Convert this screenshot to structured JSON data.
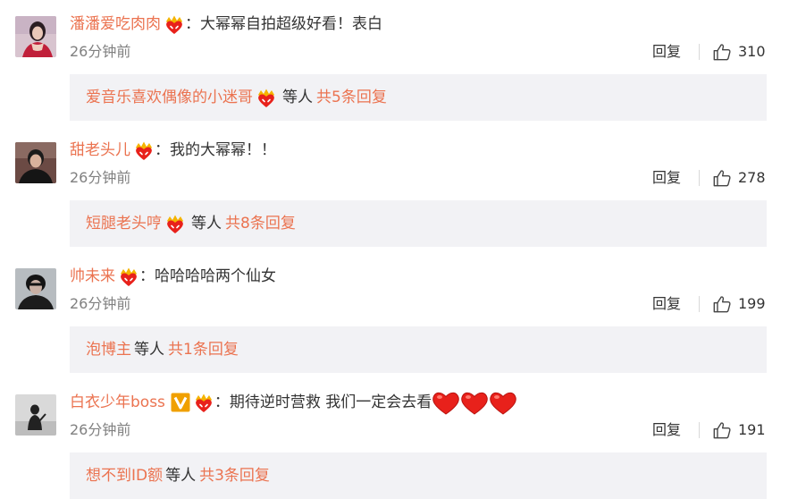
{
  "comments": [
    {
      "username": "潘潘爱吃肉肉",
      "text": "：大幂幂自拍超级好看！表白",
      "time": "26分钟前",
      "reply_label": "回复",
      "likes": "310",
      "sub": {
        "name": "爱音乐喜欢偶像的小迷哥",
        "etc": "等人",
        "total": "共5条回复",
        "has_badge": true
      }
    },
    {
      "username": "甜老头儿",
      "text": "：我的大幂幂！！",
      "time": "26分钟前",
      "reply_label": "回复",
      "likes": "278",
      "sub": {
        "name": "短腿老头哼",
        "etc": "等人",
        "total": "共8条回复",
        "has_badge": true
      }
    },
    {
      "username": "帅未来",
      "text": "：哈哈哈哈两个仙女",
      "time": "26分钟前",
      "reply_label": "回复",
      "likes": "199",
      "sub": {
        "name": "泡博主",
        "etc": "等人",
        "total": "共1条回复",
        "has_badge": false
      }
    },
    {
      "username": "白衣少年boss",
      "text": "：期待逆时营救 我们一定会去看",
      "time": "26分钟前",
      "reply_label": "回复",
      "likes": "191",
      "sub": {
        "name": "想不到ID额",
        "etc": "等人",
        "total": "共3条回复",
        "has_badge": false
      }
    }
  ],
  "icons": {
    "fan_badge": "fan-badge-icon",
    "verified": "verified-v-icon",
    "like": "thumbs-up-icon",
    "heart": "red-heart-icon"
  },
  "colors": {
    "username": "#eb7350",
    "text": "#333333",
    "meta": "#808080",
    "sub_bg": "#f2f2f5",
    "verified": "#f0a000",
    "heart": "#e8211b"
  }
}
